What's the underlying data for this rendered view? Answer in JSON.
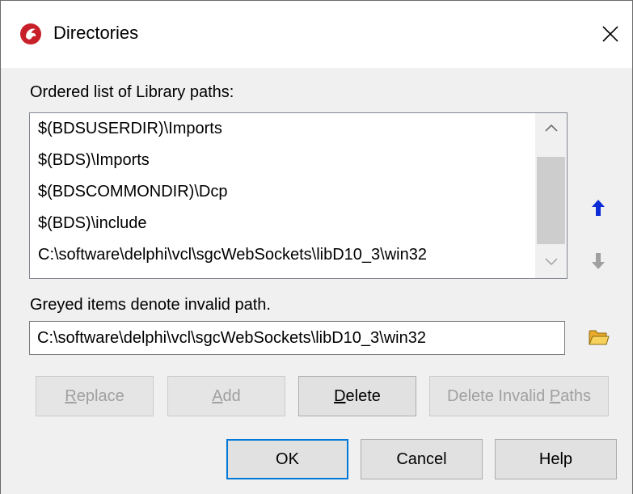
{
  "window": {
    "title": "Directories",
    "close_symbol": "✕"
  },
  "library": {
    "label": "Ordered list of Library paths:",
    "items": [
      "$(BDSUSERDIR)\\Imports",
      "$(BDS)\\Imports",
      "$(BDSCOMMONDIR)\\Dcp",
      "$(BDS)\\include",
      "C:\\software\\delphi\\vcl\\sgcWebSockets\\libD10_3\\win32"
    ]
  },
  "hint": "Greyed items denote invalid path.",
  "path_input": {
    "value": "C:\\software\\delphi\\vcl\\sgcWebSockets\\libD10_3\\win32"
  },
  "buttons": {
    "replace": {
      "accel": "R",
      "rest": "eplace"
    },
    "add": {
      "accel": "A",
      "rest": "dd"
    },
    "delete": {
      "accel": "D",
      "rest": "elete"
    },
    "delete_invalid": {
      "pre": "Delete Invalid ",
      "accel": "P",
      "rest": "aths"
    },
    "ok": "OK",
    "cancel": "Cancel",
    "help": "Help"
  },
  "colors": {
    "accent": "#0078d7",
    "arrow_enabled": "#0a2bd6",
    "arrow_disabled": "#a0a0a0",
    "folder": "#f6c343"
  }
}
